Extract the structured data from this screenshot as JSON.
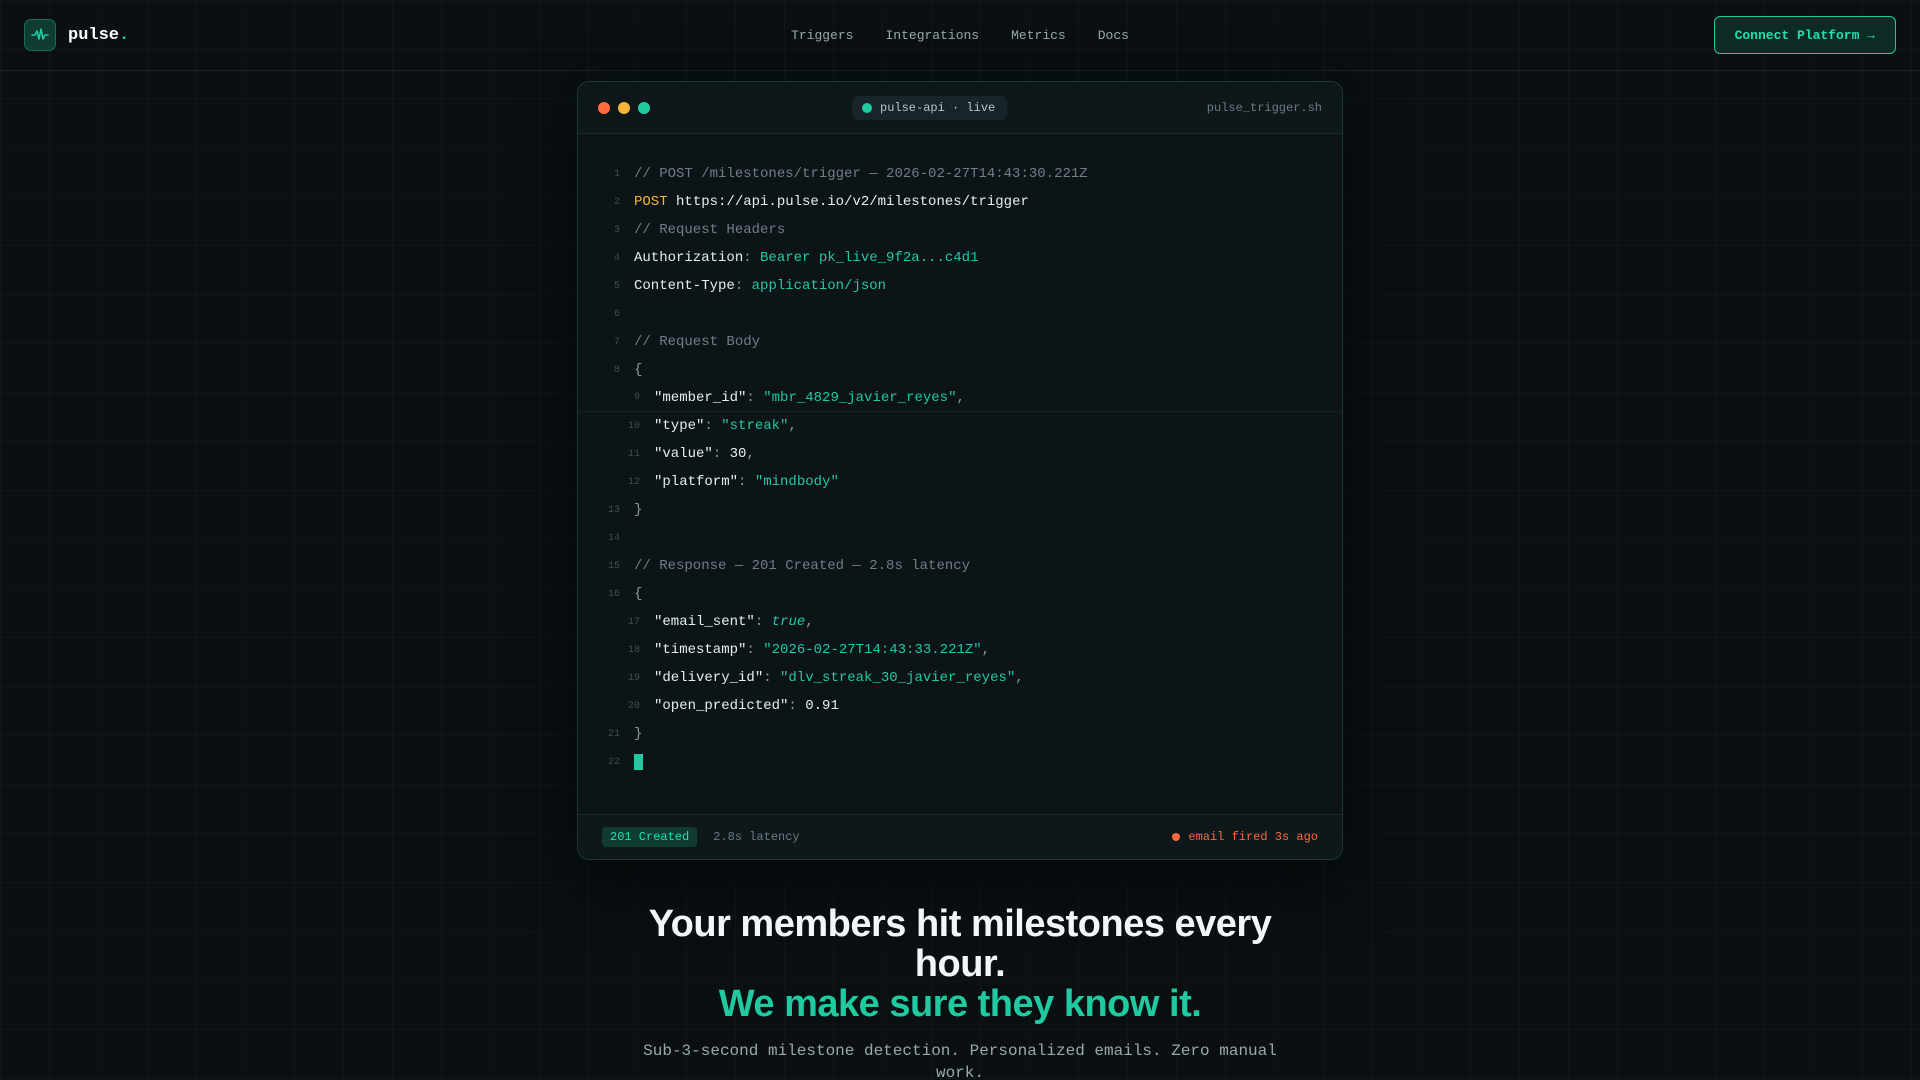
{
  "nav": {
    "brand_name": "pulse",
    "brand_dot": ".",
    "links": [
      "Triggers",
      "Integrations",
      "Metrics",
      "Docs"
    ],
    "cta_label": "Connect Platform →"
  },
  "terminal": {
    "pill_label": "pulse-api · live",
    "filename": "pulse_trigger.sh",
    "lines": {
      "l1": "// POST /milestones/trigger — 2026-02-27T14:43:30.221Z",
      "l2_method": "POST",
      "l2_url": " https://api.pulse.io/v2/milestones/trigger",
      "l3": "// Request Headers",
      "l4_key": "Authorization",
      "l4_val": "Bearer pk_live_9f2a...c4d1",
      "l5_key": "Content-Type",
      "l5_val": "application/json",
      "l7": "// Request Body",
      "brace_open": "{",
      "brace_close": "}",
      "l9_key": "\"member_id\"",
      "l9_val": "\"mbr_4829_javier_reyes\"",
      "l10_key": "\"type\"",
      "l10_val": "\"streak\"",
      "l11_key": "\"value\"",
      "l11_val": "30",
      "l12_key": "\"platform\"",
      "l12_val": "\"mindbody\"",
      "l15": "// Response — 201 Created — 2.8s latency",
      "l17_key": "\"email_sent\"",
      "l17_val": "true",
      "l18_key": "\"timestamp\"",
      "l18_val": "\"2026-02-27T14:43:33.221Z\"",
      "l19_key": "\"delivery_id\"",
      "l19_val": "\"dlv_streak_30_javier_reyes\"",
      "l20_key": "\"open_predicted\"",
      "l20_val": "0.91"
    },
    "footer": {
      "status": "201 Created",
      "latency": "2.8s latency",
      "fired": "email fired 3s ago"
    }
  },
  "hero": {
    "title": "Your members hit milestones every hour.",
    "accent": "We make sure they know it.",
    "subtitle": "Sub-3-second milestone detection. Personalized emails. Zero manual work."
  },
  "colors": {
    "accent": "#1fcaa0",
    "warning": "#f5b53a",
    "alert": "#ff6a3d",
    "background": "#0a0f12"
  },
  "icons": {
    "logo": "pulse-waveform-icon"
  }
}
